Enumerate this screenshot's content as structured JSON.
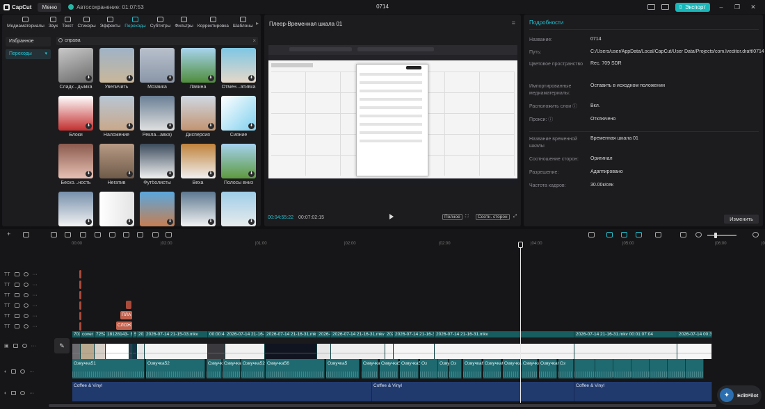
{
  "titlebar": {
    "app": "CapCut",
    "menu": "Меню",
    "autosave": "Автосохранение: 01:07:53",
    "project": "0714",
    "export": "Экспорт"
  },
  "toolbar": {
    "tabs": [
      "Медиаматериалы",
      "Звук",
      "Текст",
      "Стикеры",
      "Эффекты",
      "Переходы",
      "Субтитры",
      "Фильтры",
      "Корректировка",
      "Шаблоны"
    ],
    "active": "Переходы"
  },
  "sidebar": {
    "items": [
      "Избранное",
      "Переходы"
    ]
  },
  "search": {
    "value": "справа"
  },
  "transitions": [
    "Сладк...дымка",
    "Увеличить",
    "Мозаика",
    "Лавина",
    "Отмен...ативка",
    "Блоки",
    "Наложение",
    "Рекла...авка)",
    "Дисперсия",
    "Сияние",
    "Беско...ность",
    "Негатив",
    "Футболисты",
    "Веха",
    "Полосы вниз",
    "",
    "",
    "",
    "",
    ""
  ],
  "player": {
    "title": "Плеер-Временная шкала 01",
    "current": "00:04:55:22",
    "total": "00:07:02:15",
    "btn_full": "Полное",
    "btn_ratio": "Соотн. сторон"
  },
  "details": {
    "title": "Подробности",
    "rows": [
      {
        "label": "Название:",
        "value": "0714"
      },
      {
        "label": "Путь:",
        "value": "C:/Users/user/AppData/Local/CapCut/User Data/Projects/com.lveditor.draft/0714"
      },
      {
        "label": "Цветовое пространство",
        "value": "Rec. 709 SDR"
      },
      {
        "label": "Импортированные медиаматериалы:",
        "value": "Оставить в исходном положении"
      },
      {
        "label": "Расположить слои ⓘ",
        "value": "Вкл."
      },
      {
        "label": "Прокси: ⓘ",
        "value": "Отключено"
      },
      {
        "label": "Название временной шкалы",
        "value": "Временная шкала 01"
      },
      {
        "label": "Соотношение сторон:",
        "value": "Оригинал"
      },
      {
        "label": "Разрешение:",
        "value": "Адаптировано"
      },
      {
        "label": "Частота кадров:",
        "value": "30.00к/сек"
      }
    ],
    "edit": "Изменить"
  },
  "timeline": {
    "ruler": [
      "00:00",
      "|02:00",
      "|01:00",
      "|02:00",
      "|02:00",
      "|04:00",
      "|05:00",
      "|06:00",
      "|07:00"
    ],
    "text_clips": [
      "ПЛА",
      "СЛОЖ"
    ],
    "video_clips": [
      "701",
      "cover",
      "7252",
      "18128143-hd",
      "B",
      "54",
      "202",
      "2026-07-14 21-15-03.mkv",
      "00:00:4",
      "2026-07-14 21-16-3",
      "2026-07-14 21-16-31.mkv",
      "2026-0",
      "2026-07-14 21-16-31.mkv",
      "2026-07-",
      "2026-07-14 21-16-31.mkv",
      "2026-07-14 21-16-31.mkv",
      "2026-07-14 21-16-31.mkv 00:01:07:04",
      "2026-07-14 00:38"
    ],
    "voice_clips": [
      "Озвучка51",
      "Озвучка52",
      "Озвучка5",
      "Озвучка52",
      "Озвучка52",
      "Озвучка56",
      "Озвучка5",
      "Озвучка5",
      "Озвучка5",
      "Озвучка59",
      "Оз",
      "Озвучка6",
      "Оз",
      "Озвучка6",
      "Озвучка6",
      "Озвучка6",
      "Озвучка62",
      "Озвучка6",
      "Оз"
    ],
    "music_clips": [
      "Coffee & Vinyl",
      "Coffee & Vinyl",
      "Coffee & Vinyl"
    ]
  },
  "editpilot": {
    "label": "EditPilot"
  },
  "colors": {
    "accent": "#25c2d0",
    "export": "#18b7ba",
    "video": "#1f6f72",
    "music": "#213a6e",
    "text": "#c1624e"
  }
}
